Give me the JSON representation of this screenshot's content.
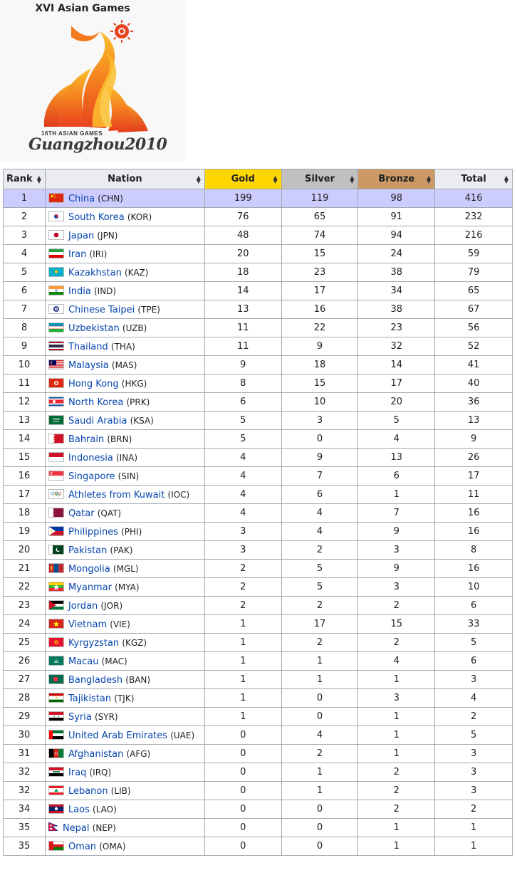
{
  "logo": {
    "title": "XVI Asian Games",
    "wordmark_top": "16TH ASIAN GAMES",
    "wordmark": "Guangzhou2010",
    "colors": {
      "flame_outer": "#e8421f",
      "flame_mid": "#f47a1e",
      "flame_inner": "#fbc02d",
      "sun": "#e8421f"
    }
  },
  "table": {
    "headers": {
      "rank": "Rank",
      "nation": "Nation",
      "gold": "Gold",
      "silver": "Silver",
      "bronze": "Bronze",
      "total": "Total"
    },
    "colors": {
      "gold": "#ffd700",
      "silver": "#c0c0c0",
      "bronze": "#cc9966",
      "host_row": "#ccccff",
      "link": "#0645ad"
    },
    "rows": [
      {
        "rank": "1",
        "nation": "China",
        "code": "(CHN)",
        "gold": "199",
        "silver": "119",
        "bronze": "98",
        "total": "416",
        "flag": "china-flag-icon",
        "colors": [
          "#de2910",
          "#ffde00"
        ],
        "host": true
      },
      {
        "rank": "2",
        "nation": "South Korea",
        "code": "(KOR)",
        "gold": "76",
        "silver": "65",
        "bronze": "91",
        "total": "232",
        "flag": "south-korea-flag-icon",
        "colors": [
          "#ffffff",
          "#cd2e3a",
          "#0047a0"
        ]
      },
      {
        "rank": "3",
        "nation": "Japan",
        "code": "(JPN)",
        "gold": "48",
        "silver": "74",
        "bronze": "94",
        "total": "216",
        "flag": "japan-flag-icon",
        "colors": [
          "#ffffff",
          "#bc002d"
        ]
      },
      {
        "rank": "4",
        "nation": "Iran",
        "code": "(IRI)",
        "gold": "20",
        "silver": "15",
        "bronze": "24",
        "total": "59",
        "flag": "iran-flag-icon",
        "colors": [
          "#239f40",
          "#ffffff",
          "#da0000"
        ]
      },
      {
        "rank": "5",
        "nation": "Kazakhstan",
        "code": "(KAZ)",
        "gold": "18",
        "silver": "23",
        "bronze": "38",
        "total": "79",
        "flag": "kazakhstan-flag-icon",
        "colors": [
          "#00afca",
          "#fec50c"
        ]
      },
      {
        "rank": "6",
        "nation": "India",
        "code": "(IND)",
        "gold": "14",
        "silver": "17",
        "bronze": "34",
        "total": "65",
        "flag": "india-flag-icon",
        "colors": [
          "#ff9933",
          "#ffffff",
          "#138808"
        ]
      },
      {
        "rank": "7",
        "nation": "Chinese Taipei",
        "code": "(TPE)",
        "gold": "13",
        "silver": "16",
        "bronze": "38",
        "total": "67",
        "flag": "chinese-taipei-flag-icon",
        "colors": [
          "#ffffff",
          "#1a3c8f",
          "#d7182a"
        ]
      },
      {
        "rank": "8",
        "nation": "Uzbekistan",
        "code": "(UZB)",
        "gold": "11",
        "silver": "22",
        "bronze": "23",
        "total": "56",
        "flag": "uzbekistan-flag-icon",
        "colors": [
          "#0099b5",
          "#ffffff",
          "#1eb53a"
        ]
      },
      {
        "rank": "9",
        "nation": "Thailand",
        "code": "(THA)",
        "gold": "11",
        "silver": "9",
        "bronze": "32",
        "total": "52",
        "flag": "thailand-flag-icon",
        "colors": [
          "#a51931",
          "#f4f5f8",
          "#2d2a4a"
        ]
      },
      {
        "rank": "10",
        "nation": "Malaysia",
        "code": "(MAS)",
        "gold": "9",
        "silver": "18",
        "bronze": "14",
        "total": "41",
        "flag": "malaysia-flag-icon",
        "colors": [
          "#cc0001",
          "#ffffff",
          "#010066"
        ]
      },
      {
        "rank": "11",
        "nation": "Hong Kong",
        "code": "(HKG)",
        "gold": "8",
        "silver": "15",
        "bronze": "17",
        "total": "40",
        "flag": "hong-kong-flag-icon",
        "colors": [
          "#de2910",
          "#ffffff"
        ]
      },
      {
        "rank": "12",
        "nation": "North Korea",
        "code": "(PRK)",
        "gold": "6",
        "silver": "10",
        "bronze": "20",
        "total": "36",
        "flag": "north-korea-flag-icon",
        "colors": [
          "#024fa2",
          "#ed1c27",
          "#ffffff"
        ]
      },
      {
        "rank": "13",
        "nation": "Saudi Arabia",
        "code": "(KSA)",
        "gold": "5",
        "silver": "3",
        "bronze": "5",
        "total": "13",
        "flag": "saudi-arabia-flag-icon",
        "colors": [
          "#006c35",
          "#ffffff"
        ]
      },
      {
        "rank": "14",
        "nation": "Bahrain",
        "code": "(BRN)",
        "gold": "5",
        "silver": "0",
        "bronze": "4",
        "total": "9",
        "flag": "bahrain-flag-icon",
        "colors": [
          "#ffffff",
          "#ce1126"
        ]
      },
      {
        "rank": "15",
        "nation": "Indonesia",
        "code": "(INA)",
        "gold": "4",
        "silver": "9",
        "bronze": "13",
        "total": "26",
        "flag": "indonesia-flag-icon",
        "colors": [
          "#ce1126",
          "#ffffff"
        ]
      },
      {
        "rank": "16",
        "nation": "Singapore",
        "code": "(SIN)",
        "gold": "4",
        "silver": "7",
        "bronze": "6",
        "total": "17",
        "flag": "singapore-flag-icon",
        "colors": [
          "#ef3340",
          "#ffffff"
        ]
      },
      {
        "rank": "17",
        "nation": "Athletes from Kuwait",
        "code": "(IOC)",
        "gold": "4",
        "silver": "6",
        "bronze": "1",
        "total": "11",
        "flag": "olympic-flag-icon",
        "colors": [
          "#ffffff",
          "#0081c8",
          "#fcb131",
          "#000000",
          "#00a651",
          "#ee334e"
        ]
      },
      {
        "rank": "18",
        "nation": "Qatar",
        "code": "(QAT)",
        "gold": "4",
        "silver": "4",
        "bronze": "7",
        "total": "16",
        "flag": "qatar-flag-icon",
        "colors": [
          "#ffffff",
          "#8a1538"
        ]
      },
      {
        "rank": "19",
        "nation": "Philippines",
        "code": "(PHI)",
        "gold": "3",
        "silver": "4",
        "bronze": "9",
        "total": "16",
        "flag": "philippines-flag-icon",
        "colors": [
          "#0038a8",
          "#ce1126",
          "#ffffff",
          "#fcd116"
        ]
      },
      {
        "rank": "20",
        "nation": "Pakistan",
        "code": "(PAK)",
        "gold": "3",
        "silver": "2",
        "bronze": "3",
        "total": "8",
        "flag": "pakistan-flag-icon",
        "colors": [
          "#ffffff",
          "#01411c"
        ]
      },
      {
        "rank": "21",
        "nation": "Mongolia",
        "code": "(MGL)",
        "gold": "2",
        "silver": "5",
        "bronze": "9",
        "total": "16",
        "flag": "mongolia-flag-icon",
        "colors": [
          "#c4272f",
          "#015197",
          "#f9cf02"
        ]
      },
      {
        "rank": "22",
        "nation": "Myanmar",
        "code": "(MYA)",
        "gold": "2",
        "silver": "5",
        "bronze": "3",
        "total": "10",
        "flag": "myanmar-flag-icon",
        "colors": [
          "#fecb00",
          "#34b233",
          "#ea2839",
          "#ffffff"
        ]
      },
      {
        "rank": "23",
        "nation": "Jordan",
        "code": "(JOR)",
        "gold": "2",
        "silver": "2",
        "bronze": "2",
        "total": "6",
        "flag": "jordan-flag-icon",
        "colors": [
          "#000000",
          "#ffffff",
          "#007a3d",
          "#ce1126"
        ]
      },
      {
        "rank": "24",
        "nation": "Vietnam",
        "code": "(VIE)",
        "gold": "1",
        "silver": "17",
        "bronze": "15",
        "total": "33",
        "flag": "vietnam-flag-icon",
        "colors": [
          "#da251d",
          "#ffff00"
        ]
      },
      {
        "rank": "25",
        "nation": "Kyrgyzstan",
        "code": "(KGZ)",
        "gold": "1",
        "silver": "2",
        "bronze": "2",
        "total": "5",
        "flag": "kyrgyzstan-flag-icon",
        "colors": [
          "#e8112d",
          "#ffef00"
        ]
      },
      {
        "rank": "26",
        "nation": "Macau",
        "code": "(MAC)",
        "gold": "1",
        "silver": "1",
        "bronze": "4",
        "total": "6",
        "flag": "macau-flag-icon",
        "colors": [
          "#00785e",
          "#ffffff",
          "#fbd116"
        ]
      },
      {
        "rank": "27",
        "nation": "Bangladesh",
        "code": "(BAN)",
        "gold": "1",
        "silver": "1",
        "bronze": "1",
        "total": "3",
        "flag": "bangladesh-flag-icon",
        "colors": [
          "#006a4e",
          "#f42a41"
        ]
      },
      {
        "rank": "28",
        "nation": "Tajikistan",
        "code": "(TJK)",
        "gold": "1",
        "silver": "0",
        "bronze": "3",
        "total": "4",
        "flag": "tajikistan-flag-icon",
        "colors": [
          "#cc0000",
          "#ffffff",
          "#006600"
        ]
      },
      {
        "rank": "29",
        "nation": "Syria",
        "code": "(SYR)",
        "gold": "1",
        "silver": "0",
        "bronze": "1",
        "total": "2",
        "flag": "syria-flag-icon",
        "colors": [
          "#ce1126",
          "#ffffff",
          "#000000",
          "#007a3d"
        ]
      },
      {
        "rank": "30",
        "nation": "United Arab Emirates",
        "code": "(UAE)",
        "gold": "0",
        "silver": "4",
        "bronze": "1",
        "total": "5",
        "flag": "uae-flag-icon",
        "colors": [
          "#00732f",
          "#ffffff",
          "#000000",
          "#ff0000"
        ]
      },
      {
        "rank": "31",
        "nation": "Afghanistan",
        "code": "(AFG)",
        "gold": "0",
        "silver": "2",
        "bronze": "1",
        "total": "3",
        "flag": "afghanistan-flag-icon",
        "colors": [
          "#000000",
          "#d32011",
          "#007a36"
        ]
      },
      {
        "rank": "32",
        "nation": "Iraq",
        "code": "(IRQ)",
        "gold": "0",
        "silver": "1",
        "bronze": "2",
        "total": "3",
        "flag": "iraq-flag-icon",
        "colors": [
          "#ce1126",
          "#ffffff",
          "#000000",
          "#007a3d"
        ]
      },
      {
        "rank": "32",
        "nation": "Lebanon",
        "code": "(LIB)",
        "gold": "0",
        "silver": "1",
        "bronze": "2",
        "total": "3",
        "flag": "lebanon-flag-icon",
        "colors": [
          "#ed1c24",
          "#ffffff",
          "#00a651"
        ]
      },
      {
        "rank": "34",
        "nation": "Laos",
        "code": "(LAO)",
        "gold": "0",
        "silver": "0",
        "bronze": "2",
        "total": "2",
        "flag": "laos-flag-icon",
        "colors": [
          "#ce1126",
          "#002868",
          "#ffffff"
        ]
      },
      {
        "rank": "35",
        "nation": "Nepal",
        "code": "(NEP)",
        "gold": "0",
        "silver": "0",
        "bronze": "1",
        "total": "1",
        "flag": "nepal-flag-icon",
        "colors": [
          "#dc143c",
          "#003893",
          "#ffffff"
        ]
      },
      {
        "rank": "35",
        "nation": "Oman",
        "code": "(OMA)",
        "gold": "0",
        "silver": "0",
        "bronze": "1",
        "total": "1",
        "flag": "oman-flag-icon",
        "colors": [
          "#db161b",
          "#ffffff",
          "#008000"
        ]
      }
    ]
  }
}
